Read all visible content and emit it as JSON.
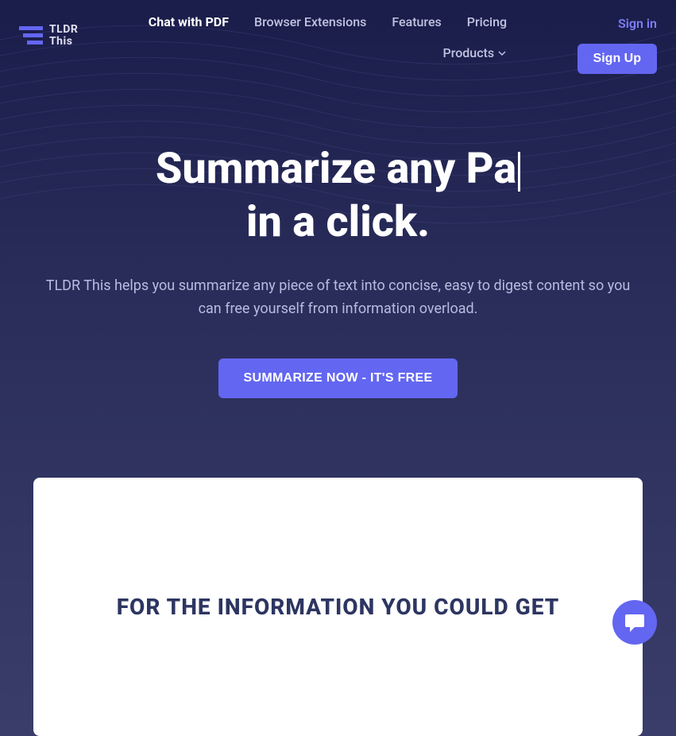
{
  "logo": {
    "text_line1": "TLDR",
    "text_line2": "This"
  },
  "nav": {
    "chat_with_pdf": "Chat with PDF",
    "browser_extensions": "Browser Extensions",
    "features": "Features",
    "pricing": "Pricing",
    "products": "Products"
  },
  "auth": {
    "signin": "Sign in",
    "signup": "Sign Up"
  },
  "hero": {
    "title_line1": "Summarize any Pa",
    "title_line2": "in a click.",
    "subtitle": "TLDR This helps you summarize any piece of text into concise, easy to digest content so you can free yourself from information overload.",
    "cta": "SUMMARIZE NOW - IT'S FREE"
  },
  "video": {
    "caption": "FOR THE INFORMATION YOU COULD GET"
  },
  "colors": {
    "primary": "#6366f1",
    "background_start": "#1a1d4a",
    "text_light": "#ffffff",
    "text_muted": "#b8bce0"
  }
}
